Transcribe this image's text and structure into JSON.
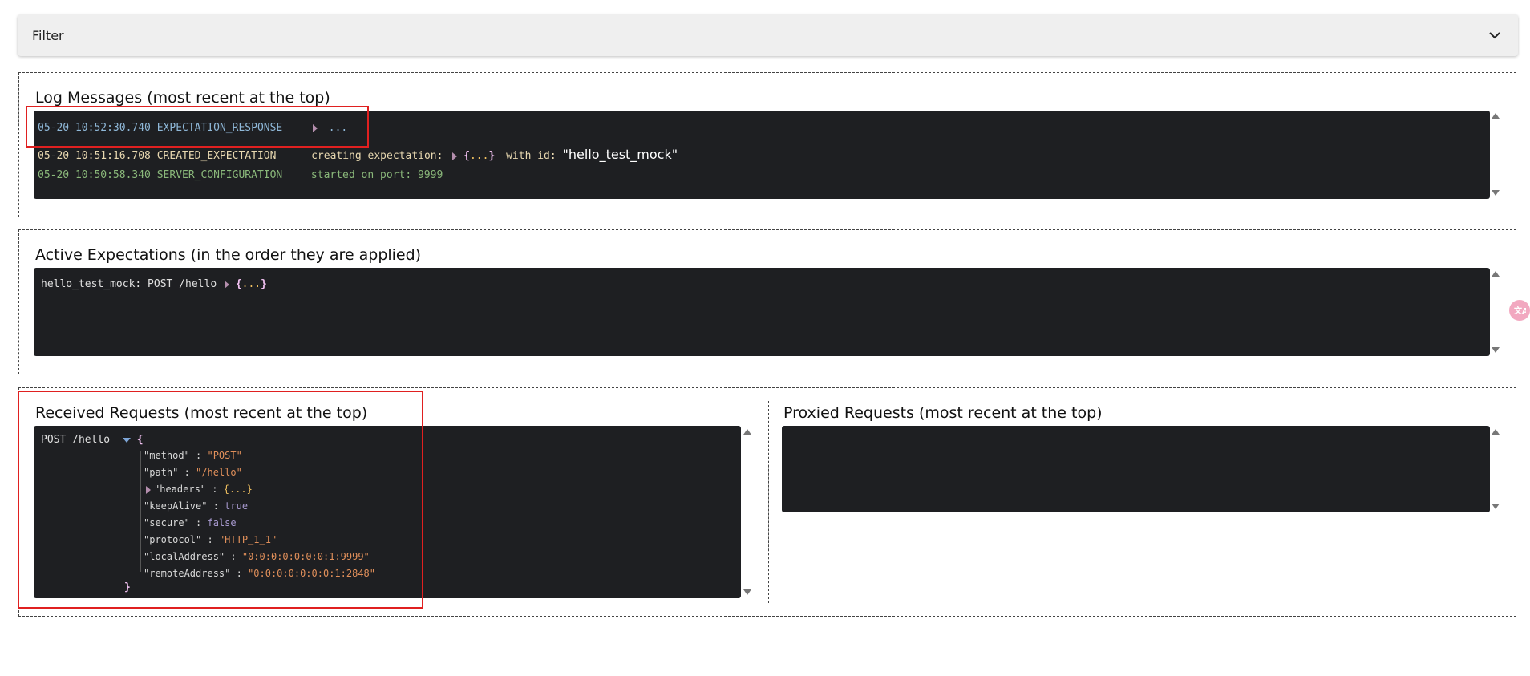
{
  "filter": {
    "label": "Filter"
  },
  "log": {
    "title": "Log Messages (most recent at the top)",
    "entries": [
      {
        "time": "05-20 10:52:30.740",
        "type": "EXPECTATION_RESPONSE",
        "ellipsis": "..."
      },
      {
        "time": "05-20 10:51:16.708",
        "type": "CREATED_EXPECTATION",
        "msg": "creating expectation:",
        "obj": "...",
        "with": "with id:",
        "id": "\"hello_test_mock\""
      },
      {
        "time": "05-20 10:50:58.340",
        "type": "SERVER_CONFIGURATION",
        "msg": "started on port: 9999"
      }
    ]
  },
  "expectations": {
    "title": "Active Expectations (in the order they are applied)",
    "items": [
      {
        "text": "hello_test_mock: POST  /hello",
        "obj": "..."
      }
    ]
  },
  "received": {
    "title": "Received Requests (most recent at the top)",
    "request": {
      "method_path": "POST  /hello",
      "open_brace": "{",
      "close_brace": "}",
      "fields": [
        {
          "key": "\"method\"",
          "sep": " : ",
          "value": "\"POST\"",
          "kind": "str"
        },
        {
          "key": "\"path\"",
          "sep": " : ",
          "value": "\"/hello\"",
          "kind": "str"
        },
        {
          "key": "\"headers\"",
          "sep": " : ",
          "value": "{...}",
          "kind": "obj"
        },
        {
          "key": "\"keepAlive\"",
          "sep": " : ",
          "value": "true",
          "kind": "bool"
        },
        {
          "key": "\"secure\"",
          "sep": " : ",
          "value": "false",
          "kind": "bool"
        },
        {
          "key": "\"protocol\"",
          "sep": " : ",
          "value": "\"HTTP_1_1\"",
          "kind": "str"
        },
        {
          "key": "\"localAddress\"",
          "sep": " : ",
          "value": "\"0:0:0:0:0:0:0:1:9999\"",
          "kind": "str"
        },
        {
          "key": "\"remoteAddress\"",
          "sep": " : ",
          "value": "\"0:0:0:0:0:0:0:1:2848\"",
          "kind": "str"
        }
      ]
    }
  },
  "proxied": {
    "title": "Proxied Requests (most recent at the top)"
  },
  "colors": {
    "log_response": "#8fb8d8",
    "log_created": "#e8d8b0",
    "log_server": "#8ab87a",
    "highlight": "#e02020"
  }
}
